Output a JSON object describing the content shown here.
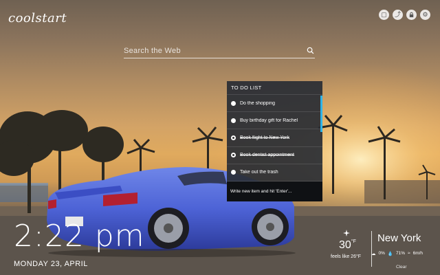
{
  "app": {
    "logo": "coolstart"
  },
  "top_icons": [
    {
      "name": "tile-icon",
      "glyph": "▢"
    },
    {
      "name": "share-icon",
      "glyph": "⤴"
    },
    {
      "name": "lock-icon",
      "glyph": "🔒"
    },
    {
      "name": "gear-icon",
      "glyph": "⚙"
    }
  ],
  "search": {
    "placeholder": "Search the Web",
    "icon": "search-icon"
  },
  "todo": {
    "title": "TO DO LIST",
    "items": [
      {
        "text": "Do the shopping",
        "done": false
      },
      {
        "text": "Buy birthday gift for Rachel",
        "done": false
      },
      {
        "text": "Book flight to New York",
        "done": true
      },
      {
        "text": "Book dentist appointment",
        "done": true
      },
      {
        "text": "Take out the trash",
        "done": false
      }
    ],
    "input_placeholder": "Write new item and hit 'Enter'...",
    "accent_color": "#2fb4e8"
  },
  "clock": {
    "time": "2:22 pm",
    "date": "MONDAY 23, APRIL"
  },
  "weather": {
    "icon": "clear-sky-icon",
    "temperature": "30",
    "unit": "°F",
    "feels_like": "feels like 26°F",
    "city": "New York",
    "precipitation": "0%",
    "humidity": "71%",
    "wind": "6m/h",
    "condition": "Clear"
  }
}
